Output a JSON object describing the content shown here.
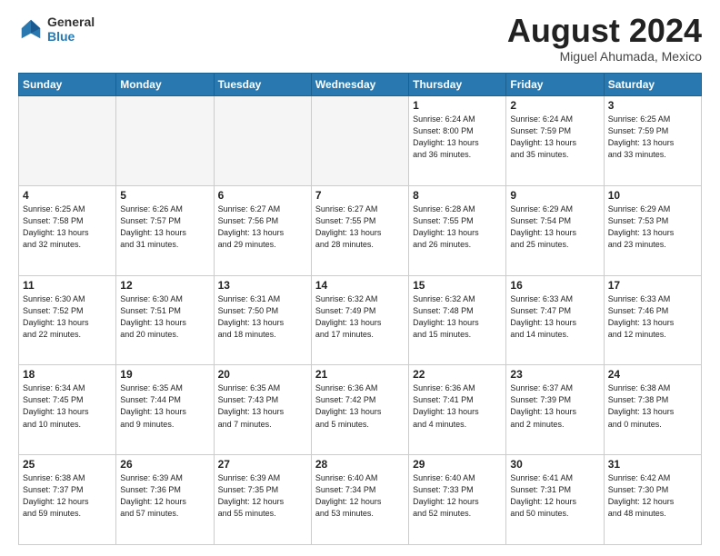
{
  "header": {
    "logo_line1": "General",
    "logo_line2": "Blue",
    "month_year": "August 2024",
    "location": "Miguel Ahumada, Mexico"
  },
  "weekdays": [
    "Sunday",
    "Monday",
    "Tuesday",
    "Wednesday",
    "Thursday",
    "Friday",
    "Saturday"
  ],
  "weeks": [
    [
      {
        "day": "",
        "info": ""
      },
      {
        "day": "",
        "info": ""
      },
      {
        "day": "",
        "info": ""
      },
      {
        "day": "",
        "info": ""
      },
      {
        "day": "1",
        "info": "Sunrise: 6:24 AM\nSunset: 8:00 PM\nDaylight: 13 hours\nand 36 minutes."
      },
      {
        "day": "2",
        "info": "Sunrise: 6:24 AM\nSunset: 7:59 PM\nDaylight: 13 hours\nand 35 minutes."
      },
      {
        "day": "3",
        "info": "Sunrise: 6:25 AM\nSunset: 7:59 PM\nDaylight: 13 hours\nand 33 minutes."
      }
    ],
    [
      {
        "day": "4",
        "info": "Sunrise: 6:25 AM\nSunset: 7:58 PM\nDaylight: 13 hours\nand 32 minutes."
      },
      {
        "day": "5",
        "info": "Sunrise: 6:26 AM\nSunset: 7:57 PM\nDaylight: 13 hours\nand 31 minutes."
      },
      {
        "day": "6",
        "info": "Sunrise: 6:27 AM\nSunset: 7:56 PM\nDaylight: 13 hours\nand 29 minutes."
      },
      {
        "day": "7",
        "info": "Sunrise: 6:27 AM\nSunset: 7:55 PM\nDaylight: 13 hours\nand 28 minutes."
      },
      {
        "day": "8",
        "info": "Sunrise: 6:28 AM\nSunset: 7:55 PM\nDaylight: 13 hours\nand 26 minutes."
      },
      {
        "day": "9",
        "info": "Sunrise: 6:29 AM\nSunset: 7:54 PM\nDaylight: 13 hours\nand 25 minutes."
      },
      {
        "day": "10",
        "info": "Sunrise: 6:29 AM\nSunset: 7:53 PM\nDaylight: 13 hours\nand 23 minutes."
      }
    ],
    [
      {
        "day": "11",
        "info": "Sunrise: 6:30 AM\nSunset: 7:52 PM\nDaylight: 13 hours\nand 22 minutes."
      },
      {
        "day": "12",
        "info": "Sunrise: 6:30 AM\nSunset: 7:51 PM\nDaylight: 13 hours\nand 20 minutes."
      },
      {
        "day": "13",
        "info": "Sunrise: 6:31 AM\nSunset: 7:50 PM\nDaylight: 13 hours\nand 18 minutes."
      },
      {
        "day": "14",
        "info": "Sunrise: 6:32 AM\nSunset: 7:49 PM\nDaylight: 13 hours\nand 17 minutes."
      },
      {
        "day": "15",
        "info": "Sunrise: 6:32 AM\nSunset: 7:48 PM\nDaylight: 13 hours\nand 15 minutes."
      },
      {
        "day": "16",
        "info": "Sunrise: 6:33 AM\nSunset: 7:47 PM\nDaylight: 13 hours\nand 14 minutes."
      },
      {
        "day": "17",
        "info": "Sunrise: 6:33 AM\nSunset: 7:46 PM\nDaylight: 13 hours\nand 12 minutes."
      }
    ],
    [
      {
        "day": "18",
        "info": "Sunrise: 6:34 AM\nSunset: 7:45 PM\nDaylight: 13 hours\nand 10 minutes."
      },
      {
        "day": "19",
        "info": "Sunrise: 6:35 AM\nSunset: 7:44 PM\nDaylight: 13 hours\nand 9 minutes."
      },
      {
        "day": "20",
        "info": "Sunrise: 6:35 AM\nSunset: 7:43 PM\nDaylight: 13 hours\nand 7 minutes."
      },
      {
        "day": "21",
        "info": "Sunrise: 6:36 AM\nSunset: 7:42 PM\nDaylight: 13 hours\nand 5 minutes."
      },
      {
        "day": "22",
        "info": "Sunrise: 6:36 AM\nSunset: 7:41 PM\nDaylight: 13 hours\nand 4 minutes."
      },
      {
        "day": "23",
        "info": "Sunrise: 6:37 AM\nSunset: 7:39 PM\nDaylight: 13 hours\nand 2 minutes."
      },
      {
        "day": "24",
        "info": "Sunrise: 6:38 AM\nSunset: 7:38 PM\nDaylight: 13 hours\nand 0 minutes."
      }
    ],
    [
      {
        "day": "25",
        "info": "Sunrise: 6:38 AM\nSunset: 7:37 PM\nDaylight: 12 hours\nand 59 minutes."
      },
      {
        "day": "26",
        "info": "Sunrise: 6:39 AM\nSunset: 7:36 PM\nDaylight: 12 hours\nand 57 minutes."
      },
      {
        "day": "27",
        "info": "Sunrise: 6:39 AM\nSunset: 7:35 PM\nDaylight: 12 hours\nand 55 minutes."
      },
      {
        "day": "28",
        "info": "Sunrise: 6:40 AM\nSunset: 7:34 PM\nDaylight: 12 hours\nand 53 minutes."
      },
      {
        "day": "29",
        "info": "Sunrise: 6:40 AM\nSunset: 7:33 PM\nDaylight: 12 hours\nand 52 minutes."
      },
      {
        "day": "30",
        "info": "Sunrise: 6:41 AM\nSunset: 7:31 PM\nDaylight: 12 hours\nand 50 minutes."
      },
      {
        "day": "31",
        "info": "Sunrise: 6:42 AM\nSunset: 7:30 PM\nDaylight: 12 hours\nand 48 minutes."
      }
    ]
  ]
}
